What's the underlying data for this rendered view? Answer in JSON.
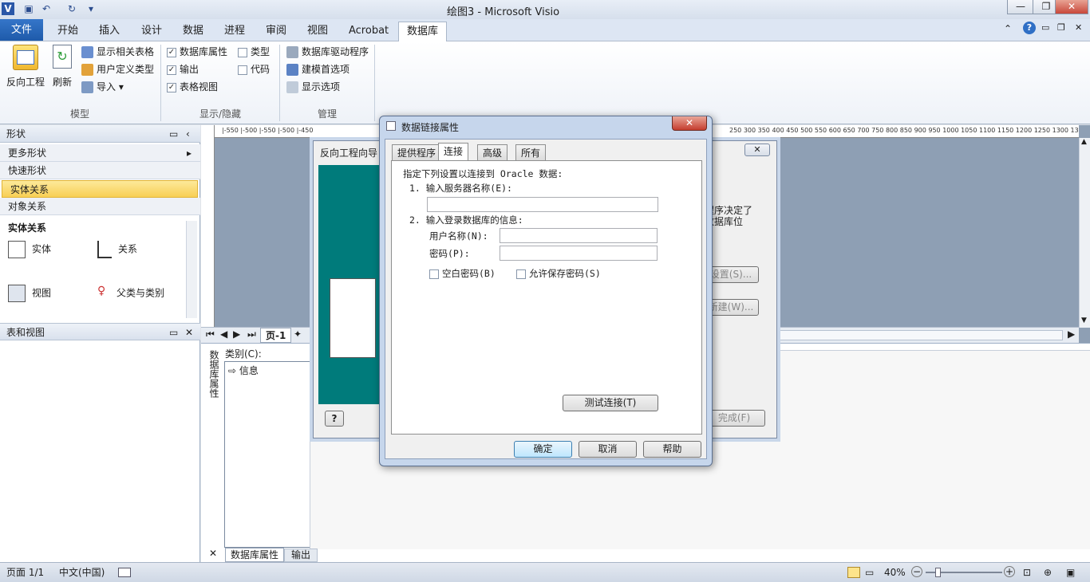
{
  "title_bar": {
    "title": "绘图3 - Microsoft Visio",
    "minimize": "—",
    "maximize": "❐",
    "close": "✕"
  },
  "ribbon_tabs": {
    "file": "文件",
    "items": [
      "开始",
      "插入",
      "设计",
      "数据",
      "进程",
      "审阅",
      "视图",
      "Acrobat",
      "数据库"
    ],
    "active": "数据库"
  },
  "ribbon": {
    "reverse_engineer": "反向工程",
    "refresh": "刷新",
    "show_related_tables": "显示相关表格",
    "user_defined_types": "用户定义类型",
    "import": "导入",
    "group_model": "模型",
    "db_properties": "数据库属性",
    "types": "类型",
    "output": "输出",
    "code": "代码",
    "table_view": "表格视图",
    "group_show_hide": "显示/隐藏",
    "db_drivers": "数据库驱动程序",
    "modeling_prefs": "建模首选项",
    "display_options": "显示选项",
    "group_manage": "管理"
  },
  "shapes_pane": {
    "title": "形状",
    "more_shapes": "更多形状",
    "quick_shapes": "快速形状",
    "entity_relationship": "实体关系",
    "object_relational": "对象关系",
    "stencil_title": "实体关系",
    "items": [
      "实体",
      "关系",
      "视图",
      "父类与类别"
    ]
  },
  "tables_pane": {
    "title": "表和视图"
  },
  "page_tabs": {
    "page1": "页-1"
  },
  "ruler_top": "|-550  |-500  |-550  |-500  |-450",
  "ruler_top_right": "250    300    350    400    450    500    550    600    650    700    750    800    850    900    950    1000   1050   1100   1150   1200   1250   1300   1350",
  "db_properties_panel": {
    "side_label": "数据库属性",
    "category_label": "类别(C):",
    "category_item": "信息",
    "tab_db_props": "数据库属性",
    "tab_output": "输出"
  },
  "wizard": {
    "title": "反向工程向导",
    "text1": "程序决定了",
    "text2": "数据库位",
    "btn_settings": "设置(S)...",
    "btn_new": "新建(W)...",
    "btn_finish": "完成(F)",
    "help_icon": "?"
  },
  "dialog": {
    "title": "数据链接属性",
    "tabs": [
      "提供程序",
      "连接",
      "高级",
      "所有"
    ],
    "active_tab": "连接",
    "instruction": "指定下列设置以连接到 Oracle 数据:",
    "step1": "1. 输入服务器名称(E):",
    "server_value": "",
    "step2": "2. 输入登录数据库的信息:",
    "username_label": "用户名称(N):",
    "username_value": "",
    "password_label": "密码(P):",
    "password_value": "",
    "blank_password": "空白密码(B)",
    "allow_save_password": "允许保存密码(S)",
    "test_connection": "测试连接(T)",
    "ok": "确定",
    "cancel": "取消",
    "help": "帮助"
  },
  "status_bar": {
    "page": "页面 1/1",
    "language": "中文(中国)",
    "zoom": "40%"
  },
  "colors": {
    "accent": "#1e5aaa",
    "wizard_teal": "#007b7b"
  }
}
